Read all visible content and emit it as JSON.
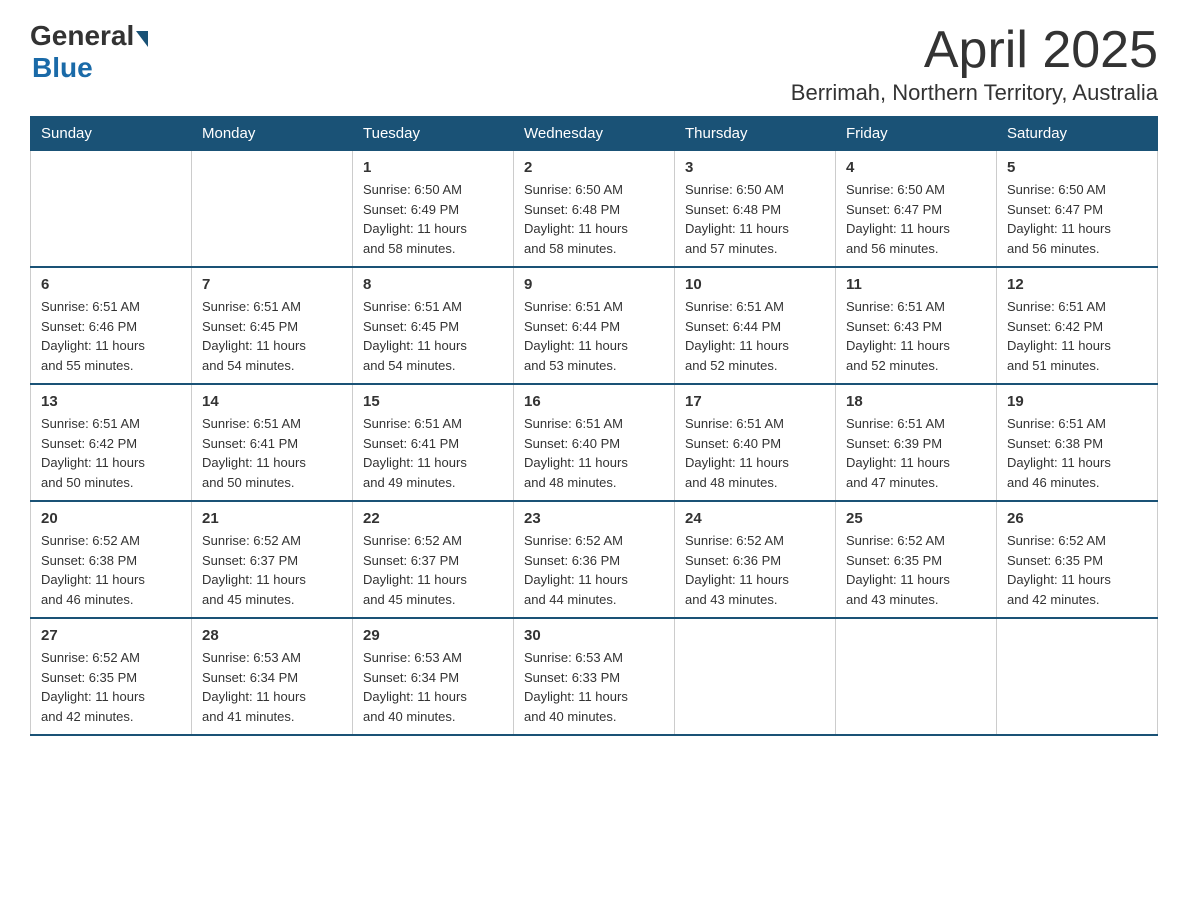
{
  "logo": {
    "general": "General",
    "blue": "Blue"
  },
  "title": "April 2025",
  "subtitle": "Berrimah, Northern Territory, Australia",
  "weekdays": [
    "Sunday",
    "Monday",
    "Tuesday",
    "Wednesday",
    "Thursday",
    "Friday",
    "Saturday"
  ],
  "weeks": [
    [
      {
        "day": "",
        "info": ""
      },
      {
        "day": "",
        "info": ""
      },
      {
        "day": "1",
        "info": "Sunrise: 6:50 AM\nSunset: 6:49 PM\nDaylight: 11 hours\nand 58 minutes."
      },
      {
        "day": "2",
        "info": "Sunrise: 6:50 AM\nSunset: 6:48 PM\nDaylight: 11 hours\nand 58 minutes."
      },
      {
        "day": "3",
        "info": "Sunrise: 6:50 AM\nSunset: 6:48 PM\nDaylight: 11 hours\nand 57 minutes."
      },
      {
        "day": "4",
        "info": "Sunrise: 6:50 AM\nSunset: 6:47 PM\nDaylight: 11 hours\nand 56 minutes."
      },
      {
        "day": "5",
        "info": "Sunrise: 6:50 AM\nSunset: 6:47 PM\nDaylight: 11 hours\nand 56 minutes."
      }
    ],
    [
      {
        "day": "6",
        "info": "Sunrise: 6:51 AM\nSunset: 6:46 PM\nDaylight: 11 hours\nand 55 minutes."
      },
      {
        "day": "7",
        "info": "Sunrise: 6:51 AM\nSunset: 6:45 PM\nDaylight: 11 hours\nand 54 minutes."
      },
      {
        "day": "8",
        "info": "Sunrise: 6:51 AM\nSunset: 6:45 PM\nDaylight: 11 hours\nand 54 minutes."
      },
      {
        "day": "9",
        "info": "Sunrise: 6:51 AM\nSunset: 6:44 PM\nDaylight: 11 hours\nand 53 minutes."
      },
      {
        "day": "10",
        "info": "Sunrise: 6:51 AM\nSunset: 6:44 PM\nDaylight: 11 hours\nand 52 minutes."
      },
      {
        "day": "11",
        "info": "Sunrise: 6:51 AM\nSunset: 6:43 PM\nDaylight: 11 hours\nand 52 minutes."
      },
      {
        "day": "12",
        "info": "Sunrise: 6:51 AM\nSunset: 6:42 PM\nDaylight: 11 hours\nand 51 minutes."
      }
    ],
    [
      {
        "day": "13",
        "info": "Sunrise: 6:51 AM\nSunset: 6:42 PM\nDaylight: 11 hours\nand 50 minutes."
      },
      {
        "day": "14",
        "info": "Sunrise: 6:51 AM\nSunset: 6:41 PM\nDaylight: 11 hours\nand 50 minutes."
      },
      {
        "day": "15",
        "info": "Sunrise: 6:51 AM\nSunset: 6:41 PM\nDaylight: 11 hours\nand 49 minutes."
      },
      {
        "day": "16",
        "info": "Sunrise: 6:51 AM\nSunset: 6:40 PM\nDaylight: 11 hours\nand 48 minutes."
      },
      {
        "day": "17",
        "info": "Sunrise: 6:51 AM\nSunset: 6:40 PM\nDaylight: 11 hours\nand 48 minutes."
      },
      {
        "day": "18",
        "info": "Sunrise: 6:51 AM\nSunset: 6:39 PM\nDaylight: 11 hours\nand 47 minutes."
      },
      {
        "day": "19",
        "info": "Sunrise: 6:51 AM\nSunset: 6:38 PM\nDaylight: 11 hours\nand 46 minutes."
      }
    ],
    [
      {
        "day": "20",
        "info": "Sunrise: 6:52 AM\nSunset: 6:38 PM\nDaylight: 11 hours\nand 46 minutes."
      },
      {
        "day": "21",
        "info": "Sunrise: 6:52 AM\nSunset: 6:37 PM\nDaylight: 11 hours\nand 45 minutes."
      },
      {
        "day": "22",
        "info": "Sunrise: 6:52 AM\nSunset: 6:37 PM\nDaylight: 11 hours\nand 45 minutes."
      },
      {
        "day": "23",
        "info": "Sunrise: 6:52 AM\nSunset: 6:36 PM\nDaylight: 11 hours\nand 44 minutes."
      },
      {
        "day": "24",
        "info": "Sunrise: 6:52 AM\nSunset: 6:36 PM\nDaylight: 11 hours\nand 43 minutes."
      },
      {
        "day": "25",
        "info": "Sunrise: 6:52 AM\nSunset: 6:35 PM\nDaylight: 11 hours\nand 43 minutes."
      },
      {
        "day": "26",
        "info": "Sunrise: 6:52 AM\nSunset: 6:35 PM\nDaylight: 11 hours\nand 42 minutes."
      }
    ],
    [
      {
        "day": "27",
        "info": "Sunrise: 6:52 AM\nSunset: 6:35 PM\nDaylight: 11 hours\nand 42 minutes."
      },
      {
        "day": "28",
        "info": "Sunrise: 6:53 AM\nSunset: 6:34 PM\nDaylight: 11 hours\nand 41 minutes."
      },
      {
        "day": "29",
        "info": "Sunrise: 6:53 AM\nSunset: 6:34 PM\nDaylight: 11 hours\nand 40 minutes."
      },
      {
        "day": "30",
        "info": "Sunrise: 6:53 AM\nSunset: 6:33 PM\nDaylight: 11 hours\nand 40 minutes."
      },
      {
        "day": "",
        "info": ""
      },
      {
        "day": "",
        "info": ""
      },
      {
        "day": "",
        "info": ""
      }
    ]
  ]
}
